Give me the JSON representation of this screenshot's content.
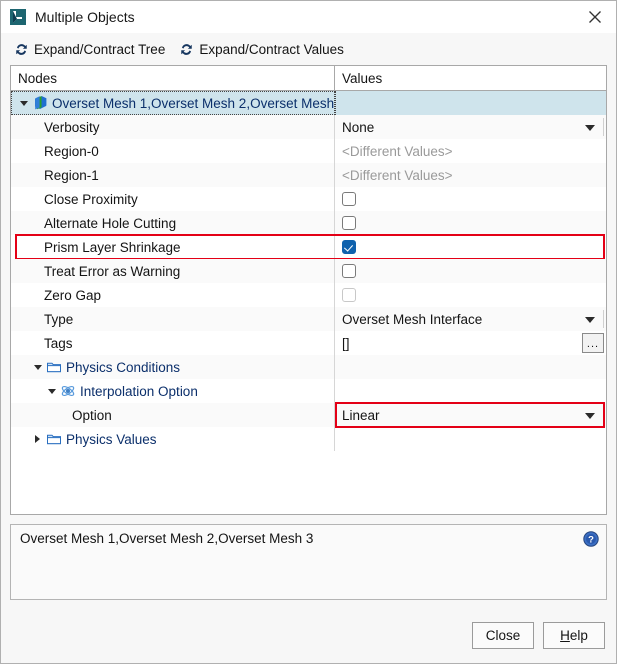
{
  "window": {
    "title": "Multiple Objects",
    "app_icon": "star-ccm-object-icon",
    "close_icon": "close-icon"
  },
  "toolbar": {
    "items": [
      {
        "label": "Expand/Contract Tree",
        "icon": "refresh-sync-icon"
      },
      {
        "label": "Expand/Contract Values",
        "icon": "refresh-sync-icon"
      }
    ]
  },
  "table": {
    "headers": {
      "nodes": "Nodes",
      "values": "Values"
    },
    "rows": [
      {
        "label": "Overset Mesh 1,Overset Mesh 2,Overset Mesh",
        "value": "",
        "type": "none",
        "indent": 0,
        "twisty": "expanded",
        "icon": "overset-mesh-icon",
        "selected": true,
        "highlight": false
      },
      {
        "label": "Verbosity",
        "value": "None",
        "type": "dropdown",
        "indent": 1,
        "twisty": "none",
        "icon": "",
        "selected": false,
        "highlight": false
      },
      {
        "label": "Region-0",
        "value": "<Different Values>",
        "type": "dimtext",
        "indent": 1,
        "twisty": "none",
        "icon": "",
        "selected": false,
        "highlight": false
      },
      {
        "label": "Region-1",
        "value": "<Different Values>",
        "type": "dimtext",
        "indent": 1,
        "twisty": "none",
        "icon": "",
        "selected": false,
        "highlight": false
      },
      {
        "label": "Close Proximity",
        "value": "unchecked",
        "type": "checkbox",
        "indent": 1,
        "twisty": "none",
        "icon": "",
        "selected": false,
        "highlight": false
      },
      {
        "label": "Alternate Hole Cutting",
        "value": "unchecked",
        "type": "checkbox",
        "indent": 1,
        "twisty": "none",
        "icon": "",
        "selected": false,
        "highlight": false
      },
      {
        "label": "Prism Layer Shrinkage",
        "value": "checked",
        "type": "checkbox",
        "indent": 1,
        "twisty": "none",
        "icon": "",
        "selected": false,
        "highlight": true
      },
      {
        "label": "Treat Error as Warning",
        "value": "unchecked",
        "type": "checkbox",
        "indent": 1,
        "twisty": "none",
        "icon": "",
        "selected": false,
        "highlight": false
      },
      {
        "label": "Zero Gap",
        "value": "disabled",
        "type": "checkbox",
        "indent": 1,
        "twisty": "none",
        "icon": "",
        "selected": false,
        "highlight": false
      },
      {
        "label": "Type",
        "value": "Overset Mesh Interface",
        "type": "dropdown",
        "indent": 1,
        "twisty": "none",
        "icon": "",
        "selected": false,
        "highlight": false
      },
      {
        "label": "Tags",
        "value": "[]",
        "type": "ellipsis",
        "indent": 1,
        "twisty": "none",
        "icon": "",
        "selected": false,
        "highlight": false,
        "ellipsis_label": "..."
      },
      {
        "label": "Physics Conditions",
        "value": "",
        "type": "none",
        "indent": 1,
        "twisty": "expanded",
        "icon": "folder-icon",
        "selected": false,
        "highlight": false
      },
      {
        "label": "Interpolation Option",
        "value": "",
        "type": "none",
        "indent": 2,
        "twisty": "expanded",
        "icon": "interpolation-option-icon",
        "selected": false,
        "highlight": false
      },
      {
        "label": "Option",
        "value": "Linear",
        "type": "dropdown",
        "indent": 3,
        "twisty": "none",
        "icon": "",
        "selected": false,
        "highlight": "value"
      },
      {
        "label": "Physics Values",
        "value": "",
        "type": "none",
        "indent": 1,
        "twisty": "collapsed",
        "icon": "folder-icon",
        "selected": false,
        "highlight": false
      }
    ]
  },
  "description": {
    "text": "Overset Mesh 1,Overset Mesh 2,Overset Mesh 3",
    "help_icon": "help-circle-icon"
  },
  "buttons": {
    "close": "Close",
    "help_prefix": "H",
    "help_rest": "elp"
  },
  "colors": {
    "selection": "#cfe4ec",
    "highlight": "#e40016",
    "checkbox_on": "#0f62ad",
    "node_blue": "#0b2f6b"
  }
}
